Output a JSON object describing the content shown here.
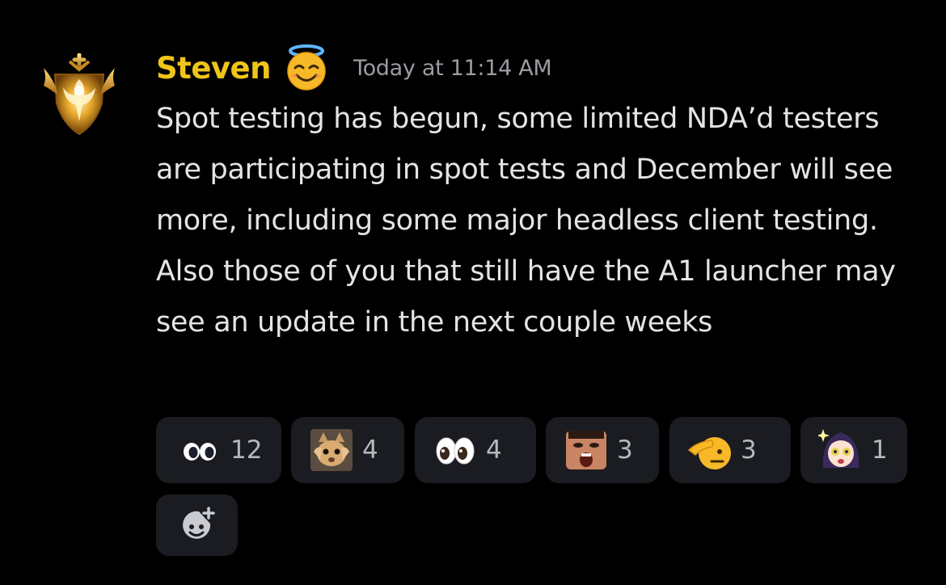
{
  "message": {
    "username": "Steven",
    "username_color": "#f0c419",
    "username_emoji": "smiling-face-with-halo-icon",
    "avatar": "golden-phoenix-emblem-icon",
    "timestamp": "Today at 11:14 AM",
    "text": "Spot testing has begun, some limited NDA’d testers are participating in spot tests and December will see more, including some major headless client testing. Also those of you that still have the A1 launcher may see an update in the next couple weeks"
  },
  "reactions": [
    {
      "emoji": "dot-eyes-icon",
      "count": "12"
    },
    {
      "emoji": "scared-cat-icon",
      "count": "4"
    },
    {
      "emoji": "eyes-icon",
      "count": "4"
    },
    {
      "emoji": "shocked-face-icon",
      "count": "3"
    },
    {
      "emoji": "saluting-face-icon",
      "count": "3"
    },
    {
      "emoji": "anime-girl-sparkle-icon",
      "count": "1"
    }
  ],
  "add_reaction": {
    "icon": "add-reaction-icon"
  }
}
